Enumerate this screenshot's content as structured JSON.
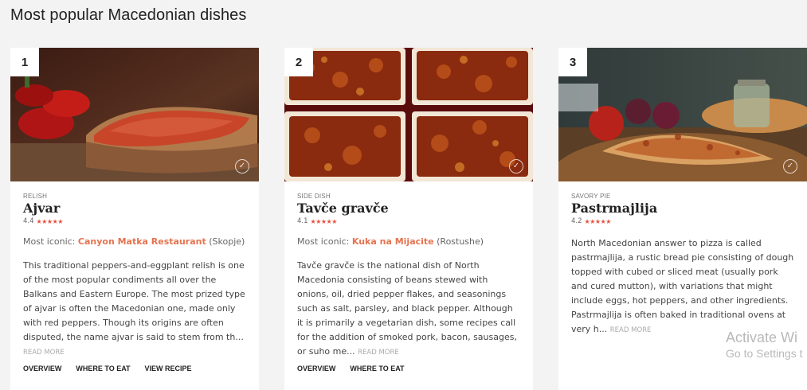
{
  "page": {
    "title": "Most popular Macedonian dishes"
  },
  "cards": [
    {
      "rank": "1",
      "category": "RELISH",
      "name": "Ajvar",
      "rating": "4.4",
      "stars_value": 4.4,
      "iconic_label": "Most iconic:",
      "restaurant": "Canyon Matka Restaurant",
      "location": "(Skopje)",
      "description": "This traditional peppers-and-eggplant relish is one of the most popular condiments all over the Balkans and Eastern Europe. The most prized type of ajvar is often the Macedonian one, made only with red peppers. Though its origins are often disputed, the name ajvar is said to stem from th...",
      "read_more": "READ MORE",
      "links": [
        "OVERVIEW",
        "WHERE TO EAT",
        "VIEW RECIPE"
      ],
      "image_icon": "ajvar-bread-image"
    },
    {
      "rank": "2",
      "category": "SIDE DISH",
      "name": "Tavče gravče",
      "rating": "4.1",
      "stars_value": 4.1,
      "iconic_label": "Most iconic:",
      "restaurant": "Kuka na Mijacite",
      "location": "(Rostushe)",
      "description": "Tavče gravče is the national dish of North Macedonia consisting of beans stewed with onions, oil, dried pepper flakes, and seasonings such as salt, parsley, and black pepper. Although it is primarily a vegetarian dish, some recipes call for the addition of smoked pork, bacon, sausages, or suho me...",
      "read_more": "READ MORE",
      "links": [
        "OVERVIEW",
        "WHERE TO EAT"
      ],
      "image_icon": "baked-beans-image"
    },
    {
      "rank": "3",
      "category": "SAVORY PIE",
      "name": "Pastrmajlija",
      "rating": "4.2",
      "stars_value": 4.2,
      "description": "North Macedonian answer to pizza is called pastrmajlija, a rustic bread pie consisting of dough topped with cubed or sliced meat (usually pork and cured mutton), with variations that might include eggs, hot peppers, and other ingredients. Pastrmajlija is often baked in traditional ovens at very h...",
      "read_more": "READ",
      "read_more_2": "MORE",
      "links": [],
      "image_icon": "pastrmajlija-pie-image"
    }
  ],
  "watermark": {
    "title": "Activate Wi",
    "subtitle": "Go to Settings t"
  },
  "colors": {
    "accent": "#e5734f",
    "stars": "#e6503c",
    "background": "#f3f3f3"
  }
}
